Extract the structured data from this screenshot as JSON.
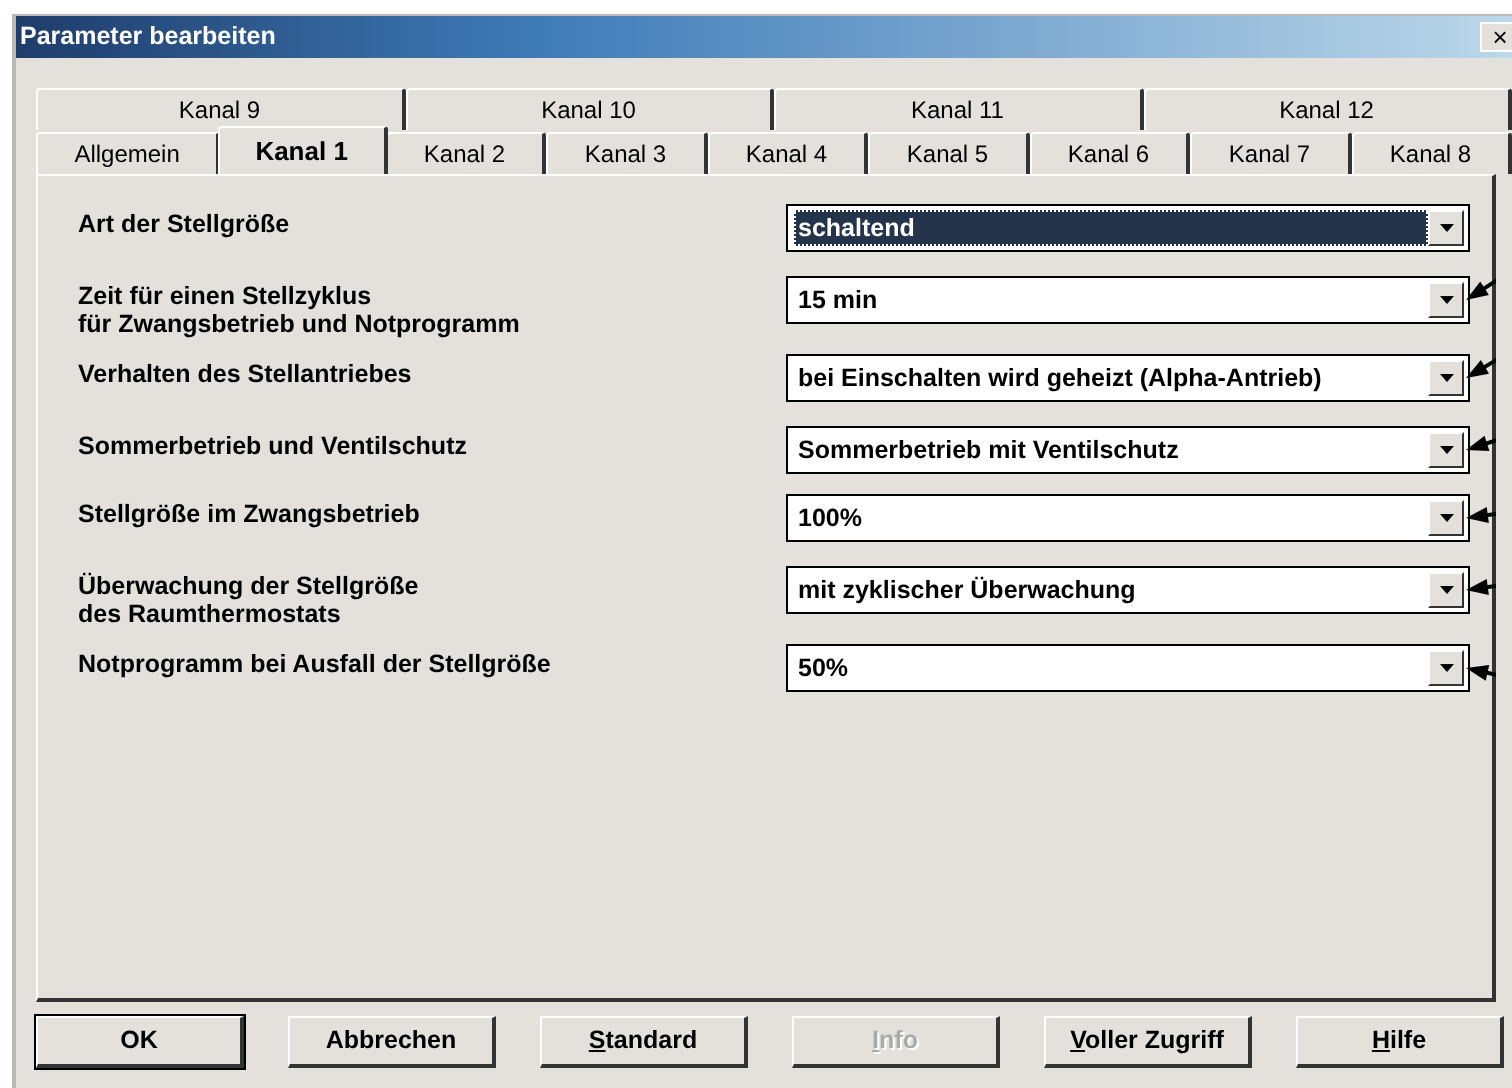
{
  "window": {
    "title": "Parameter bearbeiten",
    "close": "×"
  },
  "tab_rows": [
    [
      {
        "label": "Kanal 9",
        "selected": false
      },
      {
        "label": "Kanal 10",
        "selected": false
      },
      {
        "label": "Kanal 11",
        "selected": false
      },
      {
        "label": "Kanal 12",
        "selected": false
      }
    ],
    [
      {
        "label": "Allgemein",
        "selected": false
      },
      {
        "label": "Kanal 1",
        "selected": true
      },
      {
        "label": "Kanal 2",
        "selected": false
      },
      {
        "label": "Kanal 3",
        "selected": false
      },
      {
        "label": "Kanal 4",
        "selected": false
      },
      {
        "label": "Kanal 5",
        "selected": false
      },
      {
        "label": "Kanal 6",
        "selected": false
      },
      {
        "label": "Kanal 7",
        "selected": false
      },
      {
        "label": "Kanal 8",
        "selected": false
      }
    ]
  ],
  "parameters": [
    {
      "label": [
        "Art der Stellgröße"
      ],
      "value": "schaltend",
      "focused": true,
      "arrow": false
    },
    {
      "label": [
        "Zeit für einen Stellzyklus",
        "für Zwangsbetrieb und Notprogramm"
      ],
      "value": "15 min",
      "focused": false,
      "arrow": true
    },
    {
      "label": [
        "Verhalten des Stellantriebes"
      ],
      "value": "bei Einschalten wird geheizt (Alpha-Antrieb)",
      "focused": false,
      "arrow": true
    },
    {
      "label": [
        "Sommerbetrieb und Ventilschutz"
      ],
      "value": "Sommerbetrieb mit Ventilschutz",
      "focused": false,
      "arrow": true
    },
    {
      "label": [
        "Stellgröße im Zwangsbetrieb"
      ],
      "value": "100%",
      "focused": false,
      "arrow": true
    },
    {
      "label": [
        "Überwachung der Stellgröße",
        "des Raumthermostats"
      ],
      "value": "mit zyklischer Überwachung",
      "focused": false,
      "arrow": true
    },
    {
      "label": [
        "Notprogramm bei Ausfall der Stellgröße"
      ],
      "value": "50%",
      "focused": false,
      "arrow": true
    }
  ],
  "buttons": [
    {
      "label": "OK",
      "default": true,
      "disabled": false,
      "underline_first": false
    },
    {
      "label": "Abbrechen",
      "default": false,
      "disabled": false,
      "underline_first": false
    },
    {
      "label": "Standard",
      "default": false,
      "disabled": false,
      "underline_first": true
    },
    {
      "label": "Info",
      "default": false,
      "disabled": true,
      "underline_first": true
    },
    {
      "label": "Voller Zugriff",
      "default": false,
      "disabled": false,
      "underline_first": true
    },
    {
      "label": "Hilfe",
      "default": false,
      "disabled": false,
      "underline_first": true
    }
  ]
}
